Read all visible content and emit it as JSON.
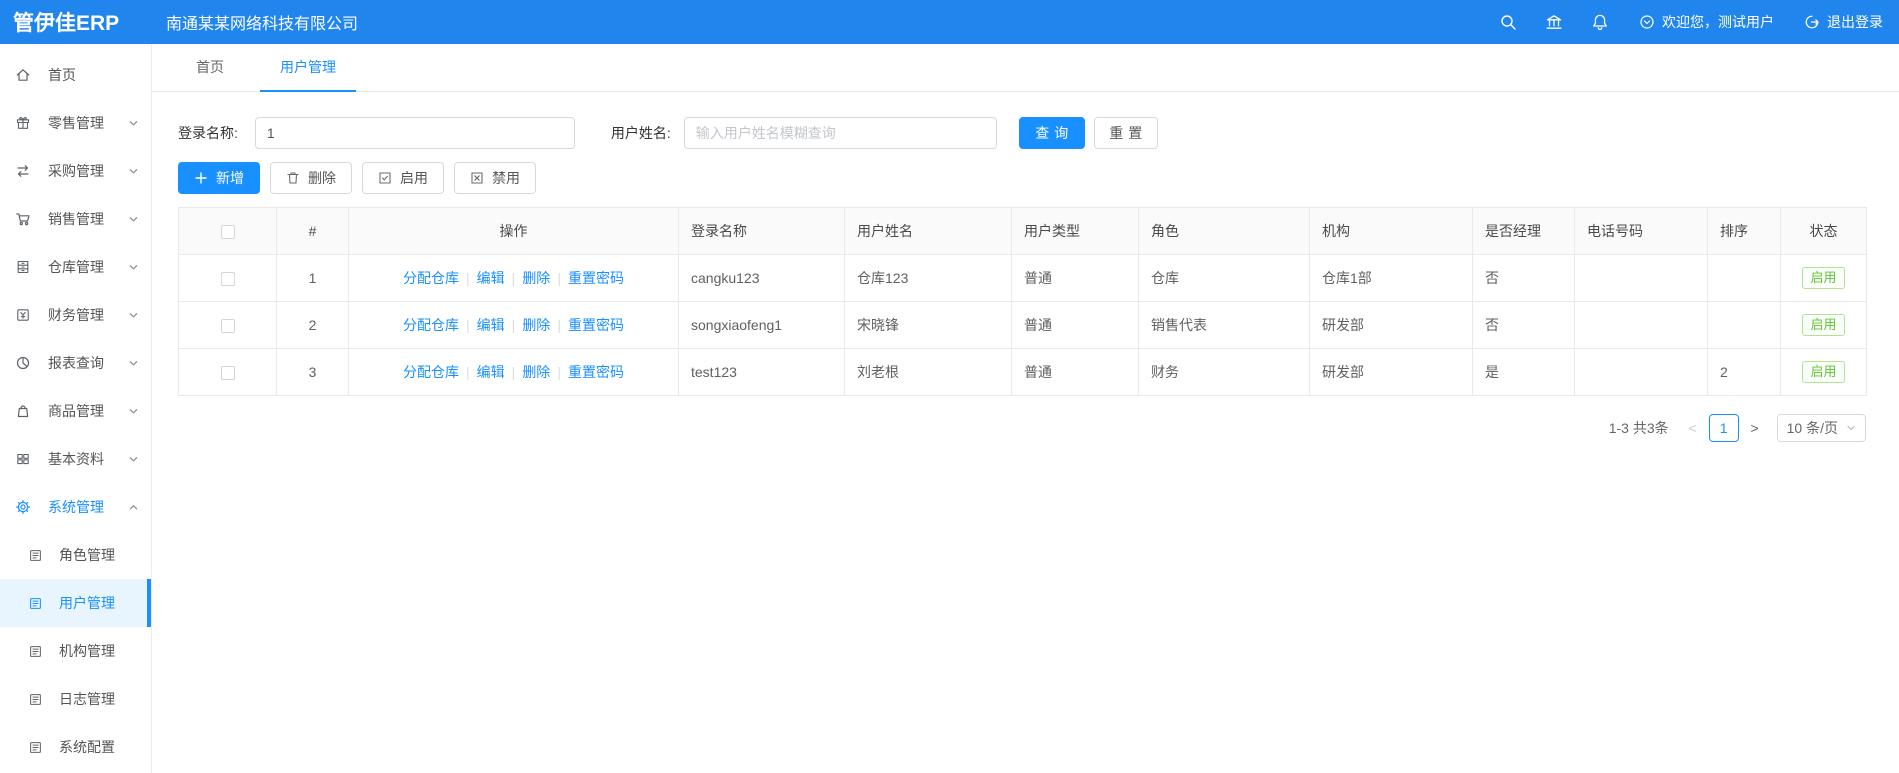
{
  "header": {
    "logo": "管伊佳ERP",
    "company": "南通某某网络科技有限公司",
    "icons": [
      "search",
      "bank",
      "bell"
    ],
    "welcome": "欢迎您，测试用户",
    "logout": "退出登录"
  },
  "sidebar": {
    "items": [
      {
        "label": "首页",
        "icon": "home",
        "chevron": "none"
      },
      {
        "label": "零售管理",
        "icon": "gift",
        "chevron": "down"
      },
      {
        "label": "采购管理",
        "icon": "swap",
        "chevron": "down"
      },
      {
        "label": "销售管理",
        "icon": "cart",
        "chevron": "down"
      },
      {
        "label": "仓库管理",
        "icon": "cabinet",
        "chevron": "down"
      },
      {
        "label": "财务管理",
        "icon": "finance",
        "chevron": "down"
      },
      {
        "label": "报表查询",
        "icon": "pie-chart",
        "chevron": "down"
      },
      {
        "label": "商品管理",
        "icon": "bag",
        "chevron": "down"
      },
      {
        "label": "基本资料",
        "icon": "grid",
        "chevron": "down"
      },
      {
        "label": "系统管理",
        "icon": "gear",
        "chevron": "up",
        "active": true
      }
    ],
    "sub_items": [
      {
        "label": "角色管理",
        "icon": "document"
      },
      {
        "label": "用户管理",
        "icon": "document",
        "active": true
      },
      {
        "label": "机构管理",
        "icon": "document"
      },
      {
        "label": "日志管理",
        "icon": "document"
      },
      {
        "label": "系统配置",
        "icon": "document"
      }
    ]
  },
  "tabs": [
    {
      "label": "首页"
    },
    {
      "label": "用户管理",
      "active": true
    }
  ],
  "filter": {
    "login_label": "登录名称:",
    "login_value": "1",
    "name_label": "用户姓名:",
    "name_placeholder": "输入用户姓名模糊查询",
    "search_btn": "查询",
    "reset_btn": "重置"
  },
  "toolbar": {
    "add": "新增",
    "delete": "删除",
    "enable": "启用",
    "disable": "禁用",
    "icons": [
      "plus",
      "trash",
      "check-square",
      "close-square"
    ]
  },
  "table": {
    "headers": [
      "#",
      "操作",
      "登录名称",
      "用户姓名",
      "用户类型",
      "角色",
      "机构",
      "是否经理",
      "电话号码",
      "排序",
      "状态"
    ],
    "op_links": [
      "分配仓库",
      "编辑",
      "删除",
      "重置密码"
    ],
    "rows": [
      {
        "num": "1",
        "login": "cangku123",
        "name": "仓库123",
        "type": "普通",
        "role": "仓库",
        "org": "仓库1部",
        "manager": "否",
        "phone": "",
        "sort": "",
        "status": "启用"
      },
      {
        "num": "2",
        "login": "songxiaofeng1",
        "name": "宋晓锋",
        "type": "普通",
        "role": "销售代表",
        "org": "研发部",
        "manager": "否",
        "phone": "",
        "sort": "",
        "status": "启用"
      },
      {
        "num": "3",
        "login": "test123",
        "name": "刘老根",
        "type": "普通",
        "role": "财务",
        "org": "研发部",
        "manager": "是",
        "phone": "",
        "sort": "2",
        "status": "启用"
      }
    ]
  },
  "pagination": {
    "total": "1-3 共3条",
    "prev": "<",
    "page": "1",
    "next": ">",
    "page_size": "10 条/页"
  },
  "colors": {
    "header_bg": "#2086ee",
    "accent": "#1890ff",
    "active_menu_bg": "#e8f4fe",
    "status_green": "#5ec432",
    "status_border": "#b1e392"
  }
}
